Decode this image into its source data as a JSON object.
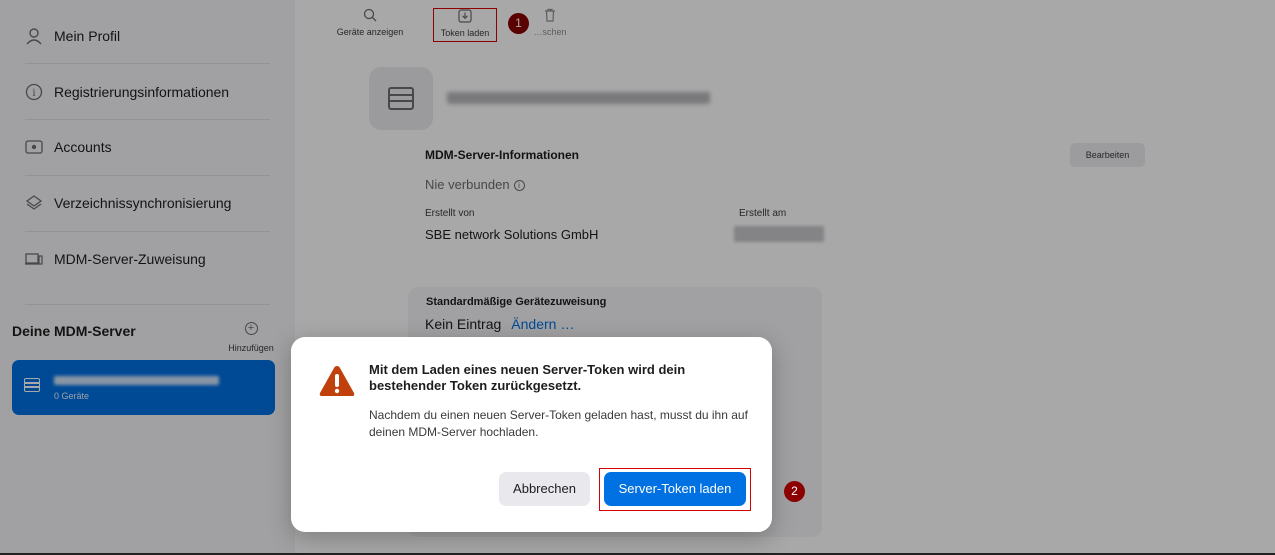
{
  "sidebar": {
    "items": [
      {
        "label": "Mein Profil",
        "icon": "person-icon"
      },
      {
        "label": "Registrierungsinformationen",
        "icon": "info-icon"
      },
      {
        "label": "Accounts",
        "icon": "apple-card-icon"
      },
      {
        "label": "Verzeichnissynchronisierung",
        "icon": "layers-icon"
      },
      {
        "label": "MDM-Server-Zuweisung",
        "icon": "laptop-icon"
      }
    ],
    "servers_title": "Deine MDM-Server",
    "add_label": "Hinzufügen",
    "server_card": {
      "count_label": "0 Geräte"
    }
  },
  "toolbar": {
    "show_devices_label": "Geräte anzeigen",
    "load_token_label": "Token laden",
    "delete_label": "…schen"
  },
  "callouts": {
    "step1": "1",
    "step2": "2"
  },
  "details": {
    "section_title": "MDM-Server-Informationen",
    "edit_label": "Bearbeiten",
    "status": "Nie verbunden",
    "created_by_label": "Erstellt von",
    "created_by_value": "SBE network Solutions GmbH",
    "created_at_label": "Erstellt am",
    "assignment_title": "Standardmäßige Gerätezuweisung",
    "assignment_value": "Kein Eintrag",
    "assignment_link": "Ändern …"
  },
  "dialog": {
    "title": "Mit dem Laden eines neuen Server-Token wird dein bestehender Token zurückgesetzt.",
    "body": "Nachdem du einen neuen Server-Token geladen hast, musst du ihn auf deinen MDM-Server hochladen.",
    "cancel_label": "Abbrechen",
    "confirm_label": "Server-Token laden"
  },
  "colors": {
    "accent": "#0071e3",
    "highlight": "#d90000",
    "badge": "#8b0000",
    "warning": "#c0410c"
  }
}
